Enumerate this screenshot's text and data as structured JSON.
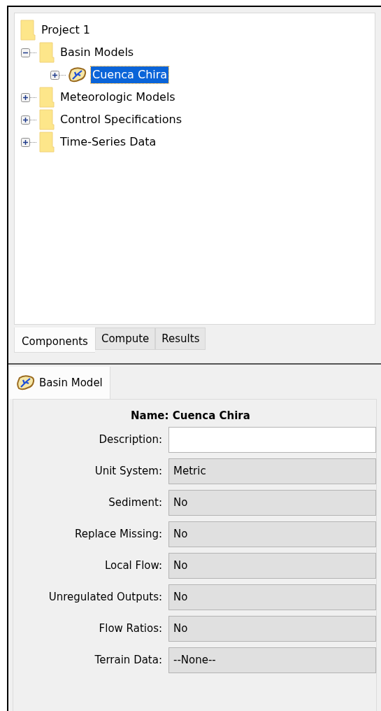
{
  "tree": {
    "label": "Project 1",
    "kind": "folder",
    "children": [
      {
        "label": "Basin Models",
        "kind": "folder",
        "expanded": true,
        "selected": false,
        "children": [
          {
            "label": "Cuenca Chira",
            "kind": "basin",
            "expanded": false,
            "selected": true
          }
        ]
      },
      {
        "label": "Meteorologic Models",
        "kind": "folder",
        "expanded": false,
        "selected": false
      },
      {
        "label": "Control Specifications",
        "kind": "folder",
        "expanded": false,
        "selected": false
      },
      {
        "label": "Time-Series Data",
        "kind": "folder",
        "expanded": false,
        "selected": false
      }
    ]
  },
  "tabs": [
    {
      "label": "Components",
      "selected": true
    },
    {
      "label": "Compute",
      "selected": false
    },
    {
      "label": "Results",
      "selected": false
    }
  ],
  "editor": {
    "tab": {
      "label": "Basin Model",
      "kind": "basin"
    },
    "name": "Name: Cuenca Chira",
    "fields": [
      {
        "label": "Description:",
        "disabled": false
      },
      {
        "label": "Unit System:",
        "value": "Metric",
        "disabled": true
      },
      {
        "label": "Sediment:",
        "value": "No",
        "disabled": true
      },
      {
        "label": "Replace Missing:",
        "value": "No",
        "disabled": true
      },
      {
        "label": "Local Flow:",
        "value": "No",
        "disabled": true
      },
      {
        "label": "Unregulated Outputs:",
        "value": "No",
        "disabled": true
      },
      {
        "label": "Flow Ratios:",
        "value": "No",
        "disabled": true
      },
      {
        "label": "Terrain Data:",
        "value": "--None--",
        "disabled": true
      }
    ]
  }
}
